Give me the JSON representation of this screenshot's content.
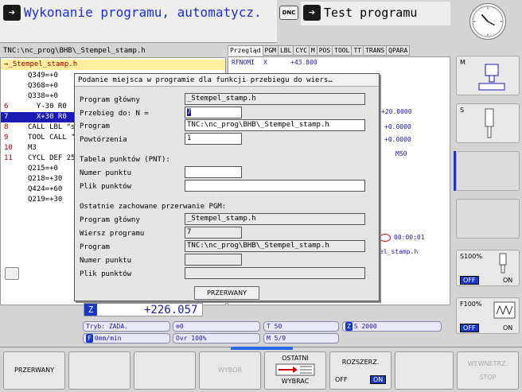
{
  "header": {
    "left_mode_title": "Wykonanie programu, automatycz.",
    "dnc_label": "DNC",
    "right_mode_title": "Test programu"
  },
  "program": {
    "path": "TNC:\\nc_prog\\BHB\\_Stempel_stamp.h",
    "selected_file": "→_Stempel_stamp.h",
    "lines": [
      {
        "num": "",
        "text": "Q349=+0"
      },
      {
        "num": "",
        "text": "Q368=+0"
      },
      {
        "num": "",
        "text": "Q338=+0"
      },
      {
        "num": "6",
        "text": "  Y-30 R0"
      },
      {
        "num": "7",
        "text": "  X+30 R0"
      },
      {
        "num": "8",
        "text": "CALL LBL \"s"
      },
      {
        "num": "9",
        "text": "TOOL CALL \""
      },
      {
        "num": "10",
        "text": "M3"
      },
      {
        "num": "11",
        "text": "CYCL DEF 25"
      },
      {
        "num": "",
        "text": "Q215=+0"
      },
      {
        "num": "",
        "text": "Q218=+30"
      },
      {
        "num": "",
        "text": "Q424=+60"
      },
      {
        "num": "",
        "text": "Q219=+30"
      }
    ]
  },
  "status": {
    "tabs": [
      "Przegląd",
      "PGM",
      "LBL",
      "CYC",
      "M",
      "POS",
      "TOOL",
      "TT",
      "TRANS",
      "QPARA"
    ],
    "rfnom_label": "RFNOMI",
    "rfnom_axis": "X",
    "rfnom_value": "+43.800",
    "values": [
      "+20.0000",
      "+0.0000",
      "+0.0000",
      "M50"
    ],
    "time": "00:00:01",
    "prog_name": "el_stamp.h"
  },
  "dialog": {
    "title": "Podanie miejsca w programie dla funkcji przebiegu do wiers…",
    "main_program_label": "Program główny",
    "main_program_value": "_Stempel_stamp.h",
    "run_to_label": "Przebieg do: N =",
    "run_to_value": "7",
    "program_label": "Program",
    "program_value": "TNC:\\nc_prog\\BHB\\_Stempel_stamp.h",
    "repeats_label": "Powtórzenia",
    "repeats_value": "1",
    "pnt_section": "Tabela punktów (PNT):",
    "point_number_label": "Numer punktu",
    "point_file_label": "Plik punktów",
    "last_break_section": "Ostatnie zachowane przerwanie PGM:",
    "last_main_program_label": "Program główny",
    "last_main_program_value": "_Stempel_stamp.h",
    "last_line_label": "Wiersz programu",
    "last_line_value": "7",
    "last_program_label": "Program",
    "last_program_value": "TNC:\\nc_prog\\BHB\\_Stempel_stamp.h",
    "last_point_number_label": "Numer punktu",
    "last_point_file_label": "Plik punktów",
    "button_label": "PRZERWANY"
  },
  "bottom_status": {
    "axis_label": "Z",
    "axis_value": "+226.057",
    "mode": "Tryb: ZADA.",
    "spindle_icon_value": "0",
    "tool": "T 50",
    "speed_axis": "Z",
    "speed": "S 2000",
    "feed_label": "F",
    "feed": "0mm/min",
    "override": "Ovr 100%",
    "m_func": "M 5/9"
  },
  "right_softkeys": {
    "m_label": "M",
    "s_label": "S",
    "s100_label": "S100%",
    "f100_label": "F100%",
    "off_label": "OFF",
    "on_label": "ON"
  },
  "bottom_softkeys": {
    "przerwany": "PRZERWANY",
    "wybor": "WYBOR",
    "ostatni_top": "OSTATNI",
    "ostatni_bottom": "WYBRAC",
    "rozszerz": "ROZSZERZ.",
    "rozszerz_off": "OFF",
    "rozszerz_on": "ON",
    "wewnetrz_top": "WEWNETRZ.",
    "wewnetrz_bottom": "STOP"
  }
}
